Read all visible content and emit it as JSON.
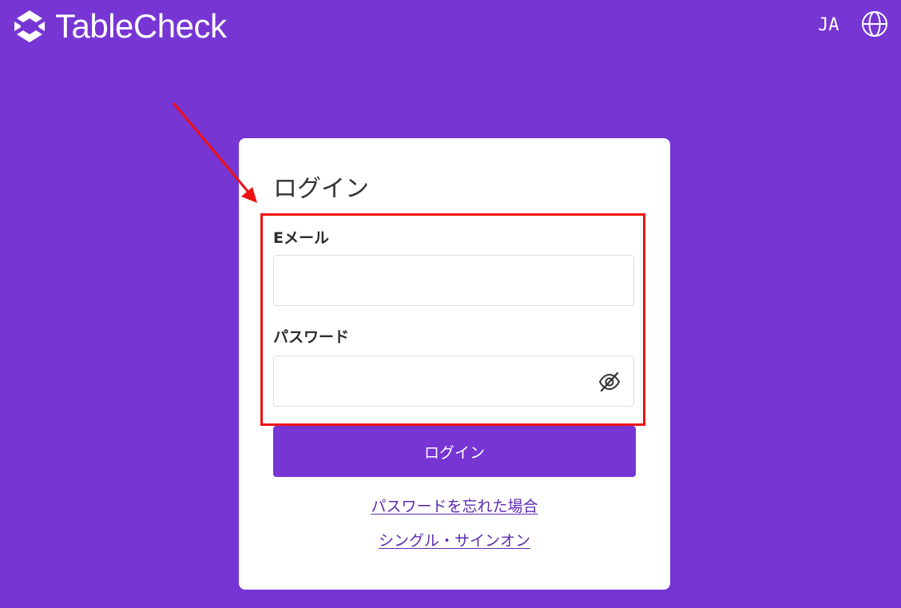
{
  "header": {
    "logo_text": "TableCheck",
    "language": "JA"
  },
  "login": {
    "title": "ログイン",
    "email_label": "Eメール",
    "email_value": "",
    "password_label": "パスワード",
    "password_value": "",
    "submit_label": "ログイン",
    "forgot_password_link": "パスワードを忘れた場合",
    "sso_link": "シングル・サインオン"
  },
  "colors": {
    "brand_purple": "#7735d4",
    "link_purple": "#5d2bb0",
    "annotation_red": "#ee1111"
  },
  "icons": {
    "logo": "tablecheck-logo-icon",
    "language": "globe-icon",
    "password_toggle": "eye-slash-icon"
  }
}
